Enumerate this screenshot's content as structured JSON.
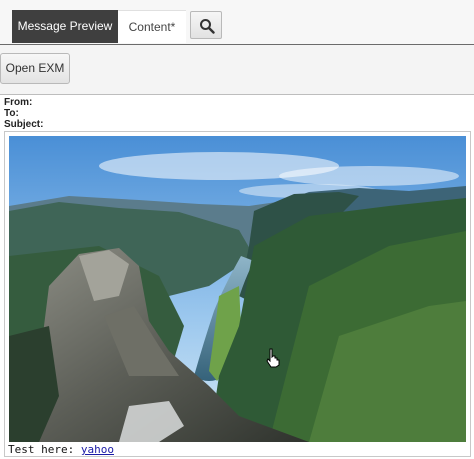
{
  "tabs": {
    "preview_label": "Message Preview",
    "content_label": "Content*"
  },
  "toolbar": {
    "search_icon": "search-icon",
    "open_label": "Open EXM"
  },
  "headers": {
    "from_label": "From:",
    "to_label": "To:",
    "subject_label": "Subject:"
  },
  "preview": {
    "image_name": "fjord-landscape-image",
    "body_text": "Test here:",
    "link_text": "yahoo"
  },
  "colors": {
    "active_tab_bg": "#3f3f3f",
    "link": "#1a1aa6"
  }
}
